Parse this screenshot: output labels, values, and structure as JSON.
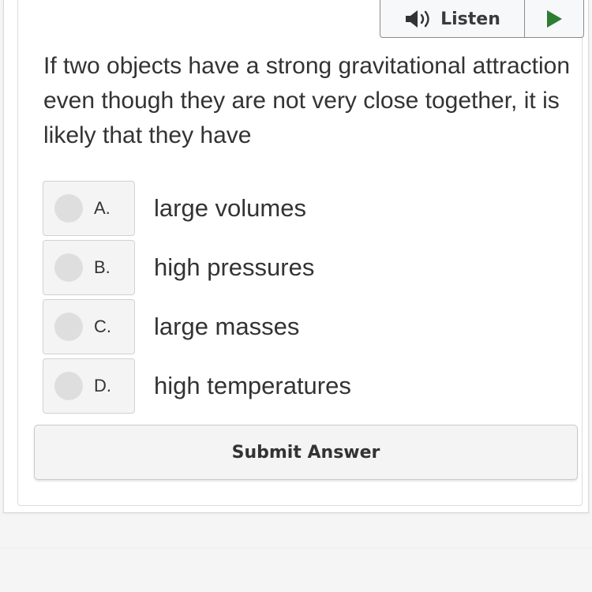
{
  "listen": {
    "label": "Listen",
    "speaker_icon": "speaker-icon",
    "play_icon": "play-icon",
    "play_color": "#2e7d32"
  },
  "question": {
    "text": "If two objects have a strong gravitational attraction even though they are not very close together, it is likely that they have"
  },
  "options": [
    {
      "letter": "A.",
      "text": "large volumes"
    },
    {
      "letter": "B.",
      "text": "high pressures"
    },
    {
      "letter": "C.",
      "text": "large masses"
    },
    {
      "letter": "D.",
      "text": "high temperatures"
    }
  ],
  "submit": {
    "label": "Submit Answer"
  }
}
